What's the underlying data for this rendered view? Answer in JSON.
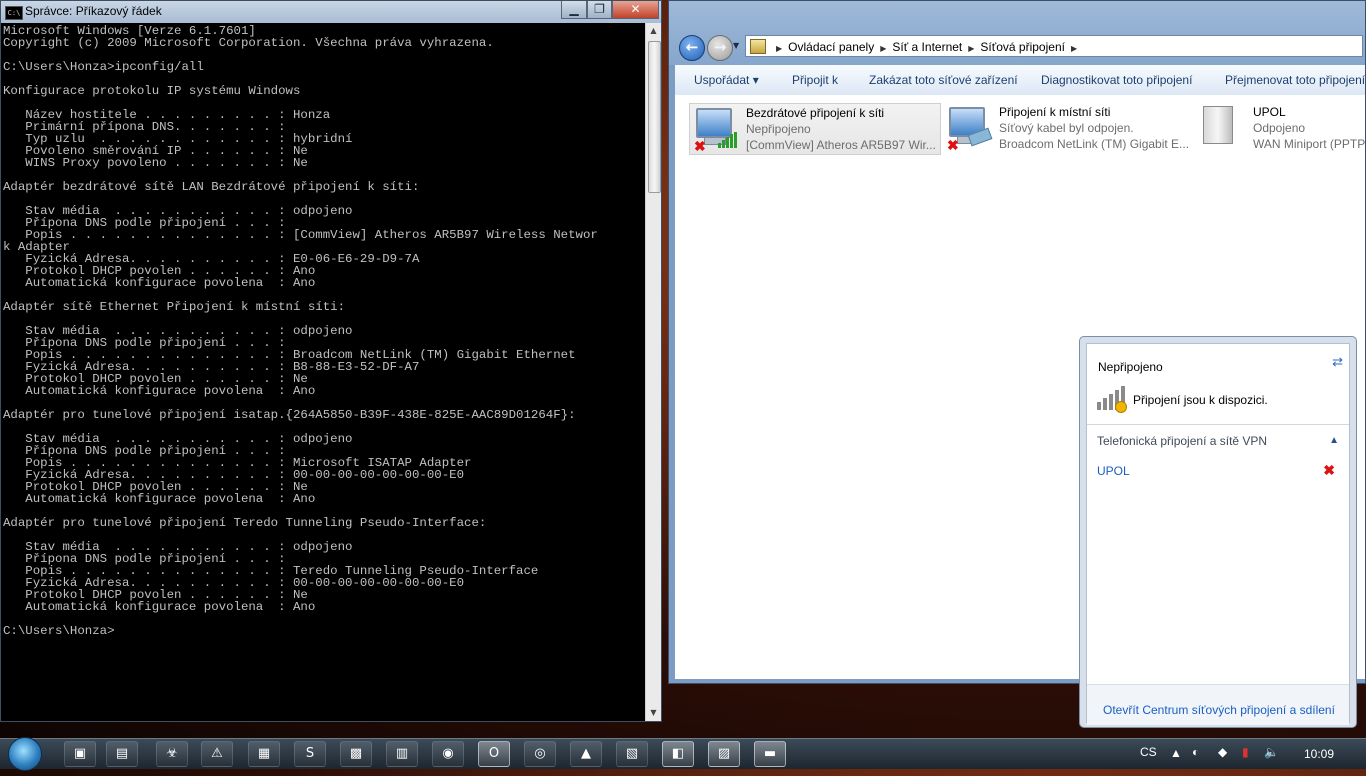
{
  "cmd": {
    "title": "Správce: Příkazový řádek",
    "icon": "cmd-icon",
    "lines": [
      "Microsoft Windows [Verze 6.1.7601]",
      "Copyright (c) 2009 Microsoft Corporation. Všechna práva vyhrazena.",
      "",
      "C:\\Users\\Honza>ipconfig/all",
      "",
      "Konfigurace protokolu IP systému Windows",
      "",
      "   Název hostitele . . . . . . . . . : Honza",
      "   Primární přípona DNS. . . . . . . :",
      "   Typ uzlu  . . . . . . . . . . . . : hybridní",
      "   Povoleno směrování IP . . . . . . : Ne",
      "   WINS Proxy povoleno . . . . . . . : Ne",
      "",
      "Adaptér bezdrátové sítě LAN Bezdrátové připojení k síti:",
      "",
      "   Stav média  . . . . . . . . . . . : odpojeno",
      "   Přípona DNS podle připojení . . . :",
      "   Popis . . . . . . . . . . . . . . : [CommView] Atheros AR5B97 Wireless Networ",
      "k Adapter",
      "   Fyzická Adresa. . . . . . . . . . : E0-06-E6-29-D9-7A",
      "   Protokol DHCP povolen . . . . . . : Ano",
      "   Automatická konfigurace povolena  : Ano",
      "",
      "Adaptér sítě Ethernet Připojení k místní síti:",
      "",
      "   Stav média  . . . . . . . . . . . : odpojeno",
      "   Přípona DNS podle připojení . . . :",
      "   Popis . . . . . . . . . . . . . . : Broadcom NetLink (TM) Gigabit Ethernet",
      "   Fyzická Adresa. . . . . . . . . . : B8-88-E3-52-DF-A7",
      "   Protokol DHCP povolen . . . . . . : Ne",
      "   Automatická konfigurace povolena  : Ano",
      "",
      "Adaptér pro tunelové připojení isatap.{264A5850-B39F-438E-825E-AAC89D01264F}:",
      "",
      "   Stav média  . . . . . . . . . . . : odpojeno",
      "   Přípona DNS podle připojení . . . :",
      "   Popis . . . . . . . . . . . . . . : Microsoft ISATAP Adapter",
      "   Fyzická Adresa. . . . . . . . . . : 00-00-00-00-00-00-00-E0",
      "   Protokol DHCP povolen . . . . . . : Ne",
      "   Automatická konfigurace povolena  : Ano",
      "",
      "Adaptér pro tunelové připojení Teredo Tunneling Pseudo-Interface:",
      "",
      "   Stav média  . . . . . . . . . . . : odpojeno",
      "   Přípona DNS podle připojení . . . :",
      "   Popis . . . . . . . . . . . . . . : Teredo Tunneling Pseudo-Interface",
      "   Fyzická Adresa. . . . . . . . . . : 00-00-00-00-00-00-00-E0",
      "   Protokol DHCP povolen . . . . . . : Ne",
      "   Automatická konfigurace povolena  : Ano",
      "",
      "C:\\Users\\Honza>"
    ]
  },
  "explorer": {
    "breadcrumbs": [
      "Ovládací panely",
      "Síť a Internet",
      "Síťová připojení"
    ],
    "toolbar": [
      "Uspořádat ▾",
      "Připojit k",
      "Zakázat toto síťové zařízení",
      "Diagnostikovat toto připojení",
      "Přejmenovat toto připojení"
    ],
    "connections": [
      {
        "name": "Bezdrátové připojení k síti",
        "status": "Nepřipojeno",
        "device": "[CommView] Atheros AR5B97 Wir..."
      },
      {
        "name": "Připojení k místní síti",
        "status": "Síťový kabel byl odpojen.",
        "device": "Broadcom NetLink (TM) Gigabit E..."
      },
      {
        "name": "UPOL",
        "status": "Odpojeno",
        "device": "WAN Miniport (PPTP"
      }
    ]
  },
  "flyout": {
    "status": "Nepřipojeno",
    "available": "Připojení jsou k dispozici.",
    "section": "Telefonická připojení a sítě VPN",
    "connection": "UPOL",
    "link": "Otevřít Centrum síťových připojení a sdílení"
  },
  "taskbar": {
    "language": "CS",
    "clock": "10:09",
    "apps": [
      "computer-icon",
      "folder-icon",
      "biohazard-icon",
      "avast-icon",
      "picture-icon",
      "skype-icon",
      "calendar-icon",
      "document-icon",
      "chrome-icon",
      "opera-icon",
      "firefox-icon",
      "vlc-icon",
      "notepad-icon",
      "photo-icon",
      "network-icon",
      "cmd-icon"
    ]
  },
  "colors": {
    "accent": "#1a5ec2",
    "error": "#dd1111",
    "console_bg": "#000000",
    "console_fg": "#c0c0c0"
  }
}
